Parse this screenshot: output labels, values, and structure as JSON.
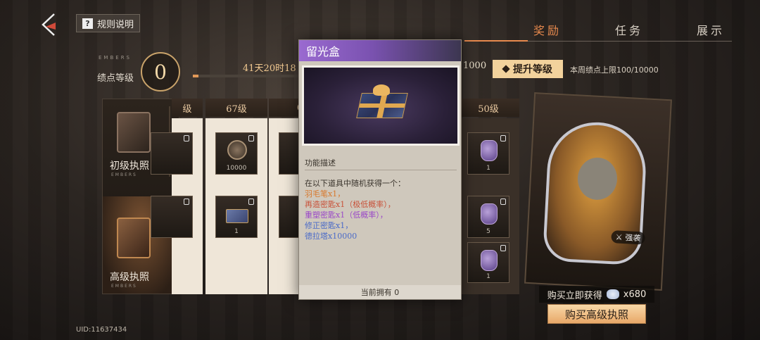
{
  "header": {
    "rules_label": "规则说明",
    "tabs": [
      {
        "label": "奖励",
        "active": true
      },
      {
        "label": "任务",
        "active": false
      },
      {
        "label": "展示",
        "active": false
      }
    ]
  },
  "level": {
    "label_small": "EMBERS",
    "label": "绩点等级",
    "value": "0",
    "timer": "41天20时18",
    "points_partial": "1000",
    "progress_fraction": 0.05,
    "upgrade_label": "提升等级",
    "weekly_cap": "本周绩点上限100/10000"
  },
  "licenses": {
    "basic_name": "初级执照",
    "basic_sub": "EMBERS",
    "advanced_name": "高级执照",
    "advanced_sub": "EMBERS"
  },
  "columns": [
    {
      "header": "级",
      "top_count": "",
      "bottom_count": ""
    },
    {
      "header": "67级",
      "top_count": "10000",
      "bottom_count": "1"
    },
    {
      "header": "6",
      "top_count": "",
      "bottom_count": ""
    },
    {
      "header": "50级",
      "top_count": "1",
      "bottom_count": "5"
    }
  ],
  "popup": {
    "title": "留光盒",
    "desc_heading": "功能描述",
    "desc_intro": "在以下道具中随机获得一个：",
    "desc_items": [
      "羽毛笔x1，",
      "再造密匙x1（极低概率），",
      "重塑密匙x1（低概率），",
      "修正密匙x1，",
      "德拉塔x10000"
    ],
    "footer": "当前拥有 0"
  },
  "character": {
    "tag": "强袭",
    "buy_get_label": "购买立即获得",
    "buy_get_amount": "x680",
    "buy_button": "购买高级执照"
  },
  "footer": {
    "uid": "UID:11637434"
  },
  "colors": {
    "accent_orange": "#e88a4e",
    "popup_title_purple": "#9a6ad0",
    "button_cream": "#f2d29c"
  }
}
